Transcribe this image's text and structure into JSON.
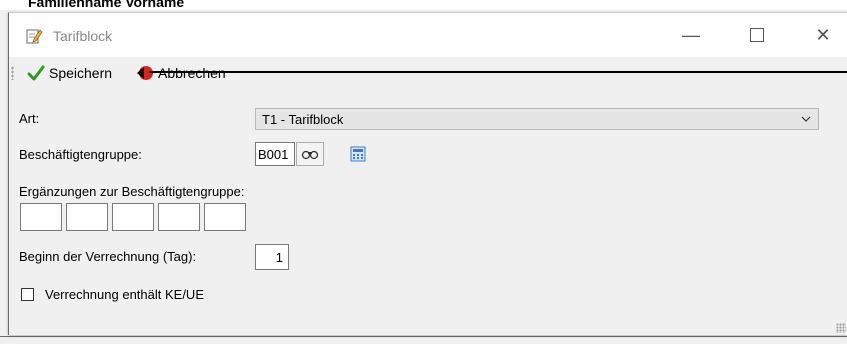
{
  "background": {
    "text": "Familienname Vorname"
  },
  "window": {
    "title": "Tarifblock",
    "controls": {
      "minimize": "—",
      "close": "✕"
    }
  },
  "toolbar": {
    "save_label": "Speichern",
    "cancel_label": "Abbrechen"
  },
  "form": {
    "art_label": "Art:",
    "art_value": "T1 - Tarifblock",
    "group_label": "Beschäftigtengruppe:",
    "group_code": "B001",
    "extensions_label": "Ergänzungen zur Beschäftigtengruppe:",
    "extensions": [
      "",
      "",
      "",
      "",
      ""
    ],
    "start_label": "Beginn der Verrechnung (Tag):",
    "start_value": "1",
    "checkbox_label": "Verrechnung enthält KE/UE",
    "checkbox_checked": false
  },
  "colors": {
    "save_check": "#2e9a1f",
    "cancel_icon": "#d7261e",
    "calc_icon": "#3a7bd5"
  }
}
